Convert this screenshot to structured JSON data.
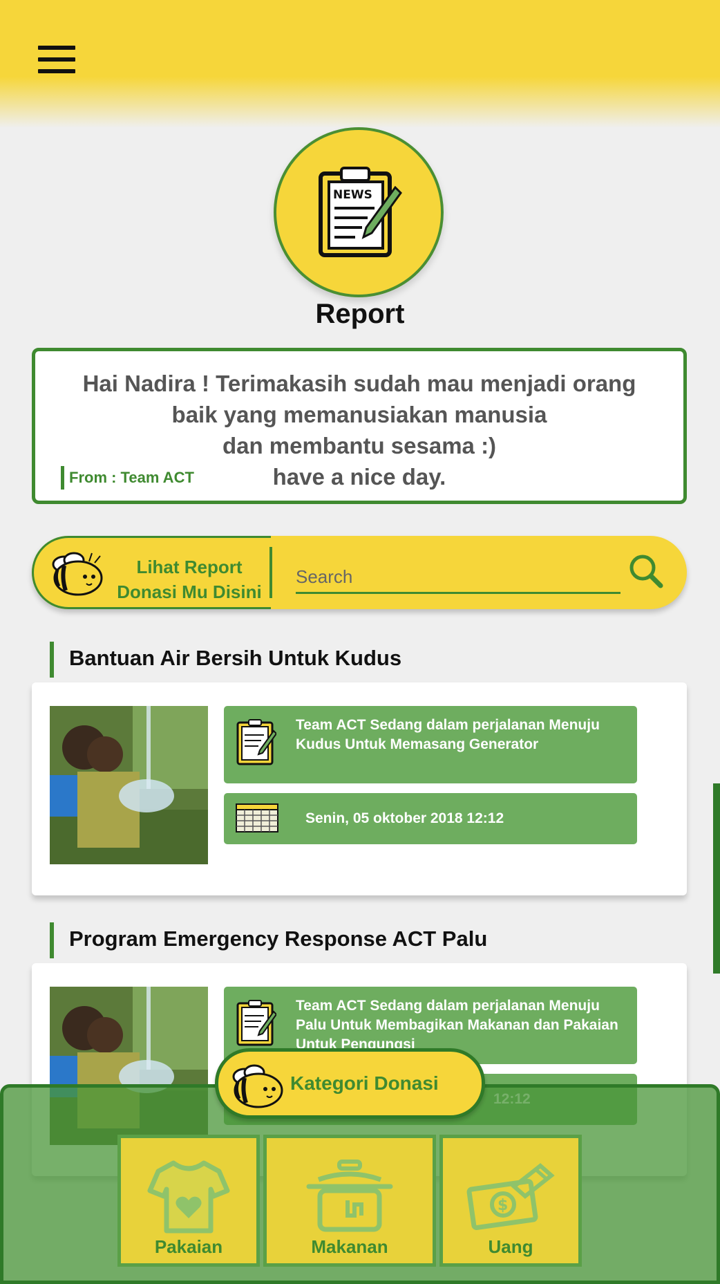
{
  "header": {
    "menu_icon": "hamburger-menu-icon"
  },
  "page": {
    "title": "Report",
    "title_icon": "news-clipboard-icon"
  },
  "greeting": {
    "lines": [
      "Hai Nadira ! Terimakasih sudah mau menjadi orang",
      "baik yang memanusiakan manusia",
      "dan membantu sesama :)",
      "have a nice day."
    ],
    "from": "From : Team ACT"
  },
  "search": {
    "label_line1": "Lihat Report",
    "label_line2": "Donasi Mu Disini",
    "placeholder": "Search",
    "icon": "search-icon"
  },
  "reports": [
    {
      "title": "Bantuan Air Bersih Untuk Kudus",
      "description": "Team ACT Sedang dalam perjalanan Menuju Kudus Untuk Memasang Generator",
      "date": "Senin, 05 oktober 2018 12:12"
    },
    {
      "title": "Program Emergency Response ACT Palu",
      "description": "Team ACT Sedang dalam perjalanan Menuju Palu Untuk Membagikan Makanan dan Pakaian Untuk Pengungsi",
      "date": "12:12"
    }
  ],
  "category": {
    "title": "Kategori Donasi",
    "items": [
      {
        "label": "Pakaian",
        "icon": "shirt-heart-icon"
      },
      {
        "label": "Makanan",
        "icon": "cooking-pot-icon"
      },
      {
        "label": "Uang",
        "icon": "money-icon"
      }
    ]
  },
  "colors": {
    "yellow": "#f6d63a",
    "green": "#3f8a30",
    "info_green": "#6ead5f"
  }
}
